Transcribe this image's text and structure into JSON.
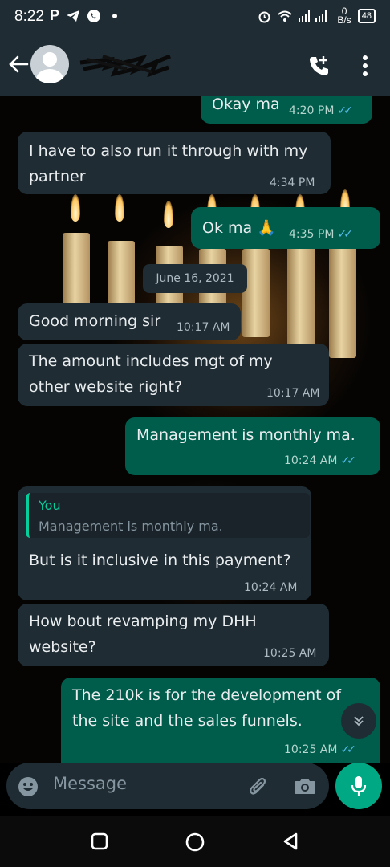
{
  "status_bar": {
    "time": "8:22",
    "net_speed_value": "0",
    "net_speed_unit": "B/s",
    "battery": "48"
  },
  "header": {
    "back_icon": "arrow-left-icon",
    "avatar_icon": "default-avatar-icon",
    "call_icon": "add-call-icon",
    "menu_icon": "more-vertical-icon"
  },
  "messages": [
    {
      "direction": "out",
      "text": "Okay ma",
      "time": "4:20 PM",
      "read": true
    },
    {
      "direction": "in",
      "lines": [
        "I have to also run it through with my",
        "partner"
      ],
      "time": "4:34 PM"
    },
    {
      "direction": "out",
      "text": "Ok ma",
      "emoji": "🙏",
      "time": "4:35 PM",
      "read": true
    },
    {
      "direction": "date",
      "text": "June 16, 2021"
    },
    {
      "direction": "in",
      "text": "Good morning sir",
      "time": "10:17 AM"
    },
    {
      "direction": "in",
      "lines": [
        "The amount includes mgt of my",
        "other website right?"
      ],
      "time": "10:17 AM"
    },
    {
      "direction": "out",
      "text": "Management is monthly ma.",
      "time": "10:24 AM",
      "read": true
    },
    {
      "direction": "in",
      "quote_author": "You",
      "quote_text": "Management is monthly ma.",
      "text": "But is it inclusive in this payment?",
      "time": "10:24 AM"
    },
    {
      "direction": "in",
      "lines": [
        "How bout revamping my DHH",
        "website?"
      ],
      "time": "10:25 AM"
    },
    {
      "direction": "out",
      "lines": [
        "The 210k is for the development of",
        "the site and the sales funnels."
      ],
      "time": "10:25 AM",
      "read": true
    }
  ],
  "compose": {
    "placeholder": "Message",
    "emoji_icon": "emoji-icon",
    "attach_icon": "paperclip-icon",
    "camera_icon": "camera-icon",
    "mic_icon": "microphone-icon"
  },
  "colors": {
    "incoming_bubble": "#1f2c33",
    "outgoing_bubble": "#005c4b",
    "accent": "#00a884",
    "read_ticks": "#53bdeb"
  }
}
